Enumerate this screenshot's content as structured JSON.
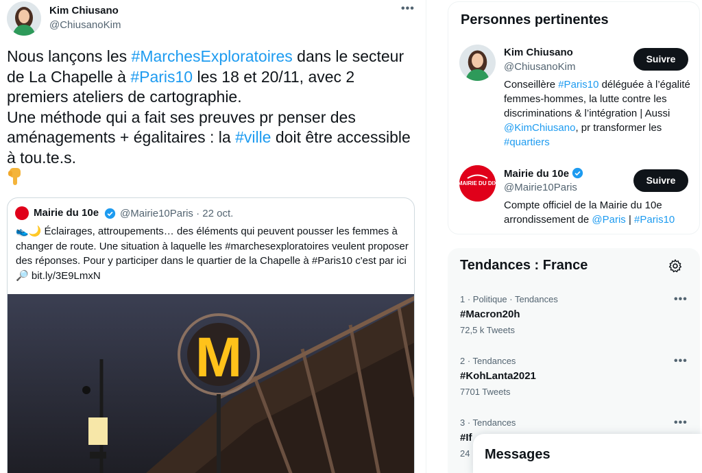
{
  "tweet": {
    "author_name": "Kim Chiusano",
    "author_handle": "@ChiusanoKim",
    "text_parts": [
      {
        "text": "Nous lançons les ",
        "tag": false
      },
      {
        "text": "#MarchesExploratoires",
        "tag": true
      },
      {
        "text": " dans le secteur de La Chapelle à ",
        "tag": false
      },
      {
        "text": "#Paris10",
        "tag": true
      },
      {
        "text": " les 18 et 20/11, avec 2 premiers ateliers de cartographie.",
        "tag": false
      },
      {
        "text": "Une méthode qui a fait ses preuves pr penser des aménagements + égalitaires : la ",
        "tag": false
      },
      {
        "text": "#ville",
        "tag": true
      },
      {
        "text": " doit être accessible à tou.te.s.",
        "tag": false
      }
    ],
    "emoji_icon": "backhand-index-pointing-down-icon"
  },
  "quote": {
    "name": "Mairie du 10e",
    "handle_date": "@Mairie10Paris · 22 oct.",
    "logo_text": "MAIRIE DU DIX",
    "text": "Éclairages, attroupements… des éléments qui peuvent pousser les femmes à changer de route. Une situation à laquelle les #marchesexploratoires veulent proposer des réponses. Pour y participer dans le quartier de la Chapelle à #Paris10 c'est par ici",
    "link": "bit.ly/3E9LmxN",
    "image_letter": "M"
  },
  "relevant": {
    "title": "Personnes pertinentes",
    "people": [
      {
        "name": "Kim Chiusano",
        "handle": "@ChiusanoKim",
        "button": "Suivre",
        "bio_parts": [
          {
            "text": "Conseillère ",
            "tag": false
          },
          {
            "text": "#Paris10",
            "tag": true
          },
          {
            "text": " déléguée à l’égalité femmes-hommes, la lutte contre les discriminations & l’intégration | Aussi ",
            "tag": false
          },
          {
            "text": "@KimChiusano",
            "tag": true
          },
          {
            "text": ", pr transformer les ",
            "tag": false
          },
          {
            "text": "#quartiers",
            "tag": true
          }
        ]
      },
      {
        "name": "Mairie du 10e",
        "handle": "@Mairie10Paris",
        "button": "Suivre",
        "logo_text": "MAIRIE DU DIX",
        "bio_parts": [
          {
            "text": "Compte officiel de la Mairie du 10e arrondissement de ",
            "tag": false
          },
          {
            "text": "@Paris",
            "tag": true
          },
          {
            "text": " | ",
            "tag": false
          },
          {
            "text": "#Paris10",
            "tag": true
          }
        ]
      }
    ]
  },
  "trends": {
    "title": "Tendances : France",
    "items": [
      {
        "meta": "1 · Politique · Tendances",
        "name": "#Macron20h",
        "count": "72,5 k Tweets"
      },
      {
        "meta": "2 · Tendances",
        "name": "#KohLanta2021",
        "count": "7701 Tweets"
      },
      {
        "meta": "3 · Tendances",
        "name": "#If",
        "count": "24"
      }
    ]
  },
  "messages": {
    "title": "Messages"
  },
  "colors": {
    "accent": "#1d9bf0",
    "mairie_red": "#e0001a",
    "button_dark": "#0f1419"
  }
}
